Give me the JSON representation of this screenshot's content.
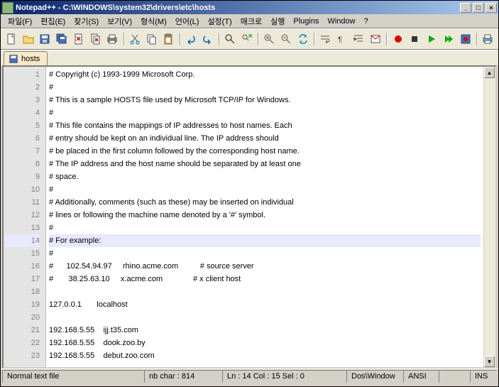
{
  "title": "Notepad++ - C:\\WINDOWS\\system32\\drivers\\etc\\hosts",
  "menu": [
    "파일(F)",
    "편집(E)",
    "찾기(S)",
    "보기(V)",
    "형식(M)",
    "언어(L)",
    "설정(T)",
    "매크로",
    "실행",
    "Plugins",
    "Window",
    "?"
  ],
  "tab": {
    "name": "hosts"
  },
  "lines": [
    "# Copyright (c) 1993-1999 Microsoft Corp.",
    "#",
    "# This is a sample HOSTS file used by Microsoft TCP/IP for Windows.",
    "#",
    "# This file contains the mappings of IP addresses to host names. Each",
    "# entry should be kept on an individual line. The IP address should",
    "# be placed in the first column followed by the corresponding host name.",
    "# The IP address and the host name should be separated by at least one",
    "# space.",
    "#",
    "# Additionally, comments (such as these) may be inserted on individual",
    "# lines or following the machine name denoted by a '#' symbol.",
    "#",
    "# For example:",
    "#",
    "#      102.54.94.97     rhino.acme.com          # source server",
    "#       38.25.63.10     x.acme.com              # x client host",
    "",
    "127.0.0.1       localhost",
    "",
    "192.168.5.55    ijj.t35.com",
    "192.168.5.55    dook.zoo.by",
    "192.168.5.55    debut.zoo.com"
  ],
  "current_line_idx": 13,
  "status": {
    "filetype": "Normal text file",
    "chars": "nb char : 814",
    "pos": "Ln : 14    Col : 15    Sel : 0",
    "eol": "Dos\\Window",
    "encoding": "ANSI",
    "mode": "INS"
  },
  "icons": {
    "new": "new-icon",
    "open": "open-icon",
    "save": "save-icon",
    "saveall": "saveall-icon",
    "close": "close-icon",
    "closeall": "closeall-icon",
    "print": "print-icon",
    "cut": "cut-icon",
    "copy": "copy-icon",
    "paste": "paste-icon",
    "undo": "undo-icon",
    "redo": "redo-icon",
    "find": "find-icon",
    "replace": "replace-icon",
    "zoomin": "zoomin-icon",
    "zoomout": "zoomout-icon",
    "sync": "sync-icon",
    "wrap": "wrap-icon",
    "allchars": "allchars-icon",
    "indent": "indent-icon",
    "lang": "lang-icon",
    "recstart": "record-start-icon",
    "recstop": "record-stop-icon",
    "play": "play-icon",
    "playmulti": "play-multi-icon",
    "recsave": "record-save-icon",
    "printer2": "printer-icon"
  }
}
